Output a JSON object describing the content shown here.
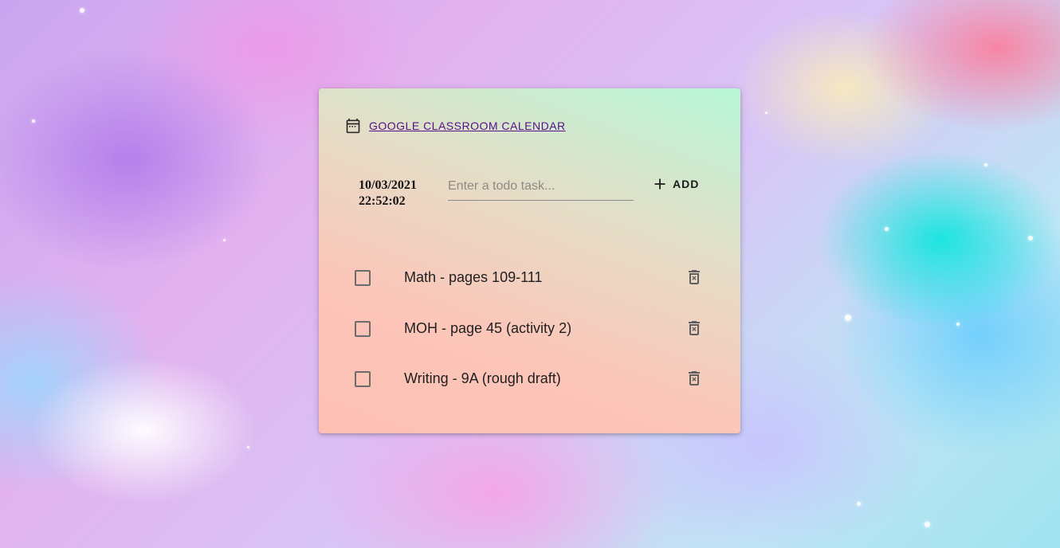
{
  "header": {
    "calendar_link_label": "GOOGLE CLASSROOM CALENDAR",
    "calendar_icon": "calendar-icon"
  },
  "clock": {
    "date": "10/03/2021",
    "time": "22:52:02"
  },
  "new_task": {
    "value": "",
    "placeholder": "Enter a todo task...",
    "add_label": "ADD",
    "add_icon": "plus-icon"
  },
  "todos": [
    {
      "text": "Math - pages 109-111",
      "checked": false
    },
    {
      "text": "MOH - page 45 (activity 2)",
      "checked": false
    },
    {
      "text": "Writing - 9A (rough draft)",
      "checked": false
    }
  ],
  "icons": {
    "delete": "delete-forever-icon"
  }
}
